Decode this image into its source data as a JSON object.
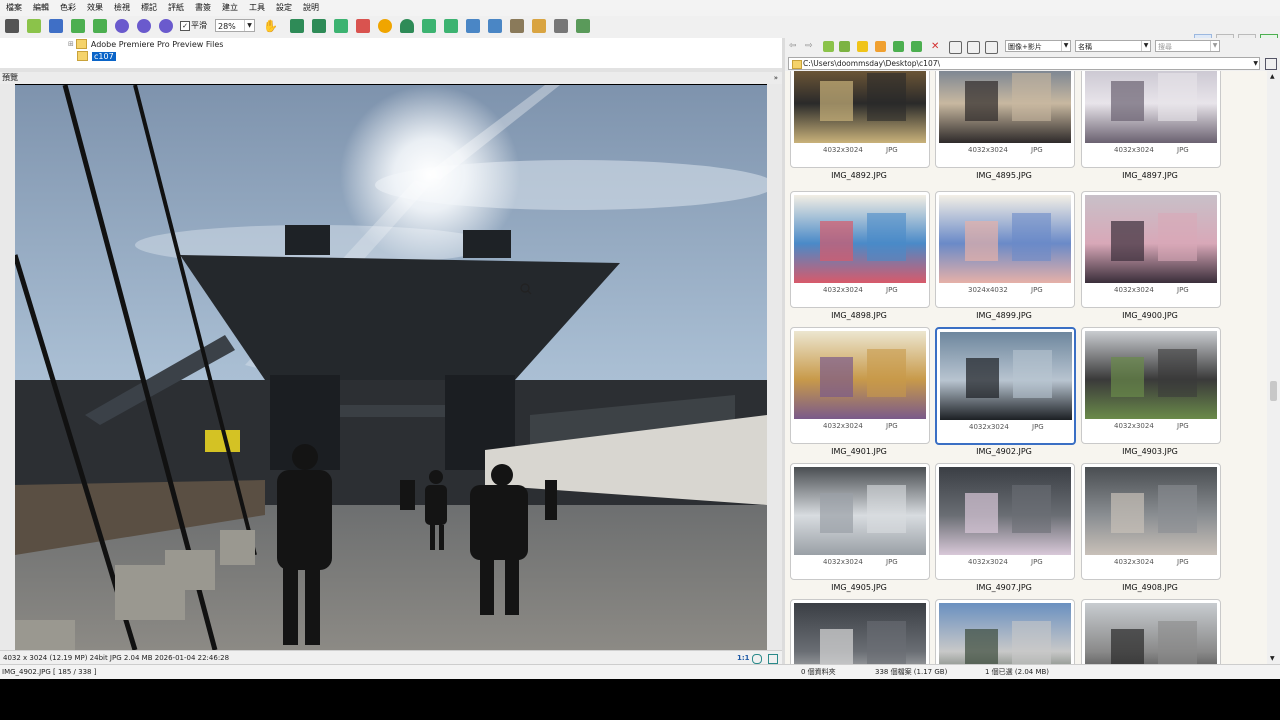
{
  "menu": [
    "檔案",
    "編輯",
    "色彩",
    "效果",
    "檢視",
    "標記",
    "評紙",
    "書簽",
    "建立",
    "工具",
    "設定",
    "說明"
  ],
  "toolbar": {
    "smooth_label": "平滑",
    "zoom_value": "28%"
  },
  "tree": {
    "items": [
      {
        "label": "Adobe Premiere Pro Preview Files",
        "selected": false
      },
      {
        "label": "c107",
        "selected": true
      }
    ]
  },
  "preview": {
    "header": "預覽",
    "status": "4032 x 3024 (12.19 MP)  24bit  JPG   2.04 MB   2026-01-04 22:46:28",
    "zoom_ratio": "1:1"
  },
  "nav": {
    "filter_value": "圖像+影片",
    "sort_value": "名稱",
    "search_placeholder": "搜尋",
    "path": "C:\\Users\\doommsday\\Desktop\\c107\\"
  },
  "thumbnails": [
    {
      "name": "IMG_4892.JPG",
      "dims": "4032x3024",
      "ext": "JPG",
      "selected": false
    },
    {
      "name": "IMG_4895.JPG",
      "dims": "4032x3024",
      "ext": "JPG",
      "selected": false
    },
    {
      "name": "IMG_4897.JPG",
      "dims": "4032x3024",
      "ext": "JPG",
      "selected": false
    },
    {
      "name": "IMG_4898.JPG",
      "dims": "4032x3024",
      "ext": "JPG",
      "selected": false
    },
    {
      "name": "IMG_4899.JPG",
      "dims": "3024x4032",
      "ext": "JPG",
      "selected": false
    },
    {
      "name": "IMG_4900.JPG",
      "dims": "4032x3024",
      "ext": "JPG",
      "selected": false
    },
    {
      "name": "IMG_4901.JPG",
      "dims": "4032x3024",
      "ext": "JPG",
      "selected": false
    },
    {
      "name": "IMG_4902.JPG",
      "dims": "4032x3024",
      "ext": "JPG",
      "selected": true
    },
    {
      "name": "IMG_4903.JPG",
      "dims": "4032x3024",
      "ext": "JPG",
      "selected": false
    },
    {
      "name": "IMG_4905.JPG",
      "dims": "4032x3024",
      "ext": "JPG",
      "selected": false
    },
    {
      "name": "IMG_4907.JPG",
      "dims": "4032x3024",
      "ext": "JPG",
      "selected": false
    },
    {
      "name": "IMG_4908.JPG",
      "dims": "4032x3024",
      "ext": "JPG",
      "selected": false
    },
    {
      "name": "",
      "dims": "",
      "ext": "",
      "selected": false
    },
    {
      "name": "",
      "dims": "",
      "ext": "",
      "selected": false
    },
    {
      "name": "",
      "dims": "",
      "ext": "",
      "selected": false
    }
  ],
  "statusbar": {
    "file": "IMG_4902.JPG [ 185 / 338 ]",
    "folders": "0 個資料夾",
    "files": "338 個檔案 (1.17 GB)",
    "selected": "1 個已選 (2.04 MB)"
  }
}
